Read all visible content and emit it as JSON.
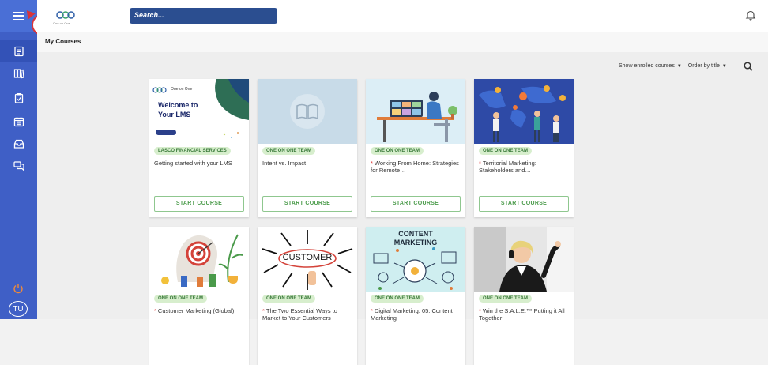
{
  "header": {
    "logo_text": "One on One",
    "search_placeholder": "Search..."
  },
  "annotation": "1",
  "subbar": {
    "title": "My Courses"
  },
  "filters": {
    "enrolled": "Show enrolled courses",
    "order": "Order by title"
  },
  "user": {
    "initials": "TU"
  },
  "sidebar": {
    "items": [
      "courses-icon",
      "library-icon",
      "clipboard-icon",
      "calendar-icon",
      "inbox-icon",
      "chat-icon"
    ]
  },
  "cards": [
    {
      "tag": "LASCO FINANCIAL SERVICES",
      "title": "Getting started with your LMS",
      "starred": false,
      "button": "START COURSE",
      "thumb": {
        "brand": "One on One",
        "line1": "Welcome to",
        "line2": "Your LMS"
      }
    },
    {
      "tag": "ONE ON ONE TEAM",
      "title": "Intent vs. Impact",
      "starred": false,
      "button": "START COURSE"
    },
    {
      "tag": "ONE ON ONE TEAM",
      "title": "Working From Home: Strategies for Remote…",
      "starred": true,
      "button": "START COURSE"
    },
    {
      "tag": "ONE ON ONE TEAM",
      "title": "Territorial Marketing: Stakeholders and…",
      "starred": true,
      "button": "START COURSE"
    },
    {
      "tag": "ONE ON ONE TEAM",
      "title": "Customer Marketing (Global)",
      "starred": true
    },
    {
      "tag": "ONE ON ONE TEAM",
      "title": "The Two Essential Ways to Market to Your Customers",
      "starred": true,
      "thumb": {
        "word": "CUSTOMER"
      }
    },
    {
      "tag": "ONE ON ONE TEAM",
      "title": "Digital Marketing: 05. Content Marketing",
      "starred": true,
      "thumb": {
        "line1": "CONTENT",
        "line2": "MARKETING"
      }
    },
    {
      "tag": "ONE ON ONE TEAM",
      "title": "Win the S.A.L.E.™ Putting it All Together",
      "starred": true
    }
  ]
}
